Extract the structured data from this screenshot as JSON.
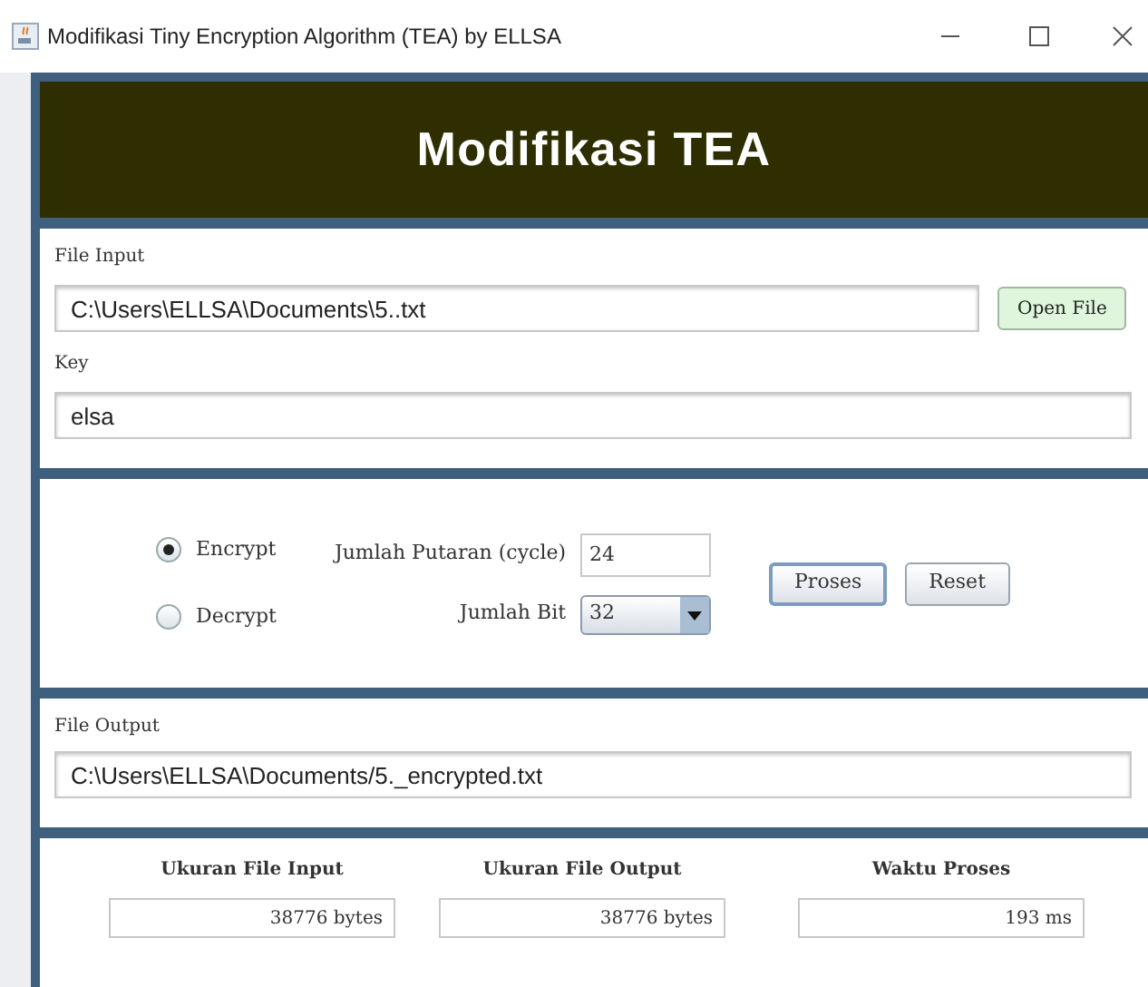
{
  "window": {
    "title": "Modifikasi Tiny Encryption Algorithm (TEA) by ELLSA"
  },
  "header": {
    "title": "Modifikasi TEA"
  },
  "file_input": {
    "label": "File Input",
    "value": "C:\\Users\\ELLSA\\Documents\\5..txt",
    "button": "Open File"
  },
  "key": {
    "label": "Key",
    "value": "elsa"
  },
  "modes": [
    {
      "label": "Encrypt",
      "selected": true
    },
    {
      "label": "Decrypt",
      "selected": false
    }
  ],
  "cycles": {
    "label": "Jumlah Putaran (cycle)",
    "value": "24"
  },
  "bits": {
    "label": "Jumlah Bit",
    "value": "32"
  },
  "buttons": [
    {
      "label": "Proses",
      "focused": true
    },
    {
      "label": "Reset",
      "focused": false
    }
  ],
  "file_output": {
    "label": "File Output",
    "value": "C:\\Users\\ELLSA\\Documents/5._encrypted.txt"
  },
  "stats": [
    {
      "label": "Ukuran File Input",
      "value": "38776 bytes"
    },
    {
      "label": "Ukuran File Output",
      "value": "38776 bytes"
    },
    {
      "label": "Waktu Proses",
      "value": "193 ms"
    }
  ]
}
